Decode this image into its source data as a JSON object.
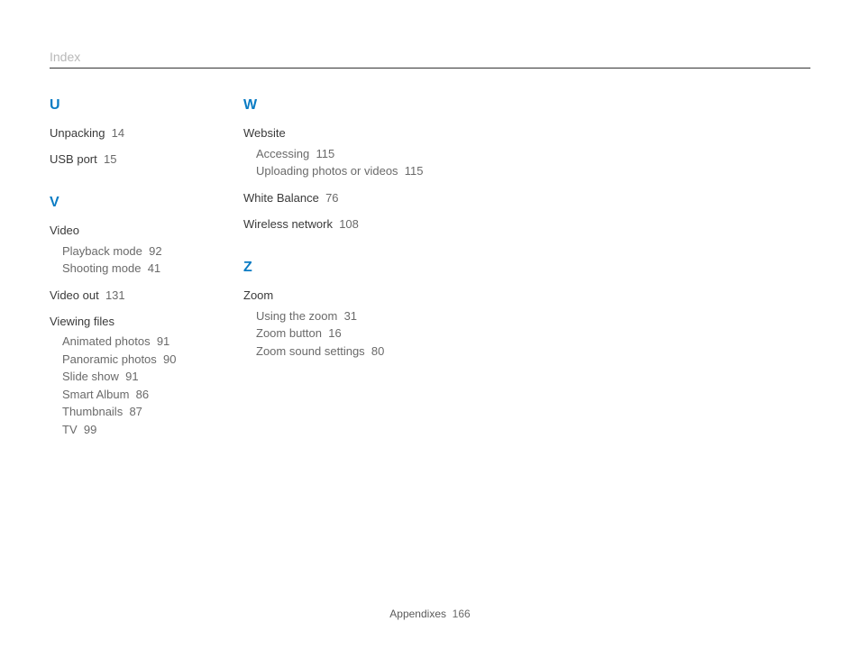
{
  "header": {
    "title": "Index"
  },
  "footer": {
    "section": "Appendixes",
    "page": "166"
  },
  "columns": [
    {
      "groups": [
        {
          "letter": "U",
          "entries": [
            {
              "term": "Unpacking",
              "page": "14"
            },
            {
              "term": "USB port",
              "page": "15"
            }
          ]
        },
        {
          "letter": "V",
          "entries": [
            {
              "term": "Video",
              "subs": [
                {
                  "term": "Playback mode",
                  "page": "92"
                },
                {
                  "term": "Shooting mode",
                  "page": "41"
                }
              ]
            },
            {
              "term": "Video out",
              "page": "131"
            },
            {
              "term": "Viewing files",
              "subs": [
                {
                  "term": "Animated photos",
                  "page": "91"
                },
                {
                  "term": "Panoramic photos",
                  "page": "90"
                },
                {
                  "term": "Slide show",
                  "page": "91"
                },
                {
                  "term": "Smart Album",
                  "page": "86"
                },
                {
                  "term": "Thumbnails",
                  "page": "87"
                },
                {
                  "term": "TV",
                  "page": "99"
                }
              ]
            }
          ]
        }
      ]
    },
    {
      "groups": [
        {
          "letter": "W",
          "entries": [
            {
              "term": "Website",
              "subs": [
                {
                  "term": "Accessing",
                  "page": "115"
                },
                {
                  "term": "Uploading photos or videos",
                  "page": "115"
                }
              ]
            },
            {
              "term": "White Balance",
              "page": "76"
            },
            {
              "term": "Wireless network",
              "page": "108"
            }
          ]
        },
        {
          "letter": "Z",
          "entries": [
            {
              "term": "Zoom",
              "subs": [
                {
                  "term": "Using the zoom",
                  "page": "31"
                },
                {
                  "term": "Zoom button",
                  "page": "16"
                },
                {
                  "term": "Zoom sound settings",
                  "page": "80"
                }
              ]
            }
          ]
        }
      ]
    }
  ]
}
